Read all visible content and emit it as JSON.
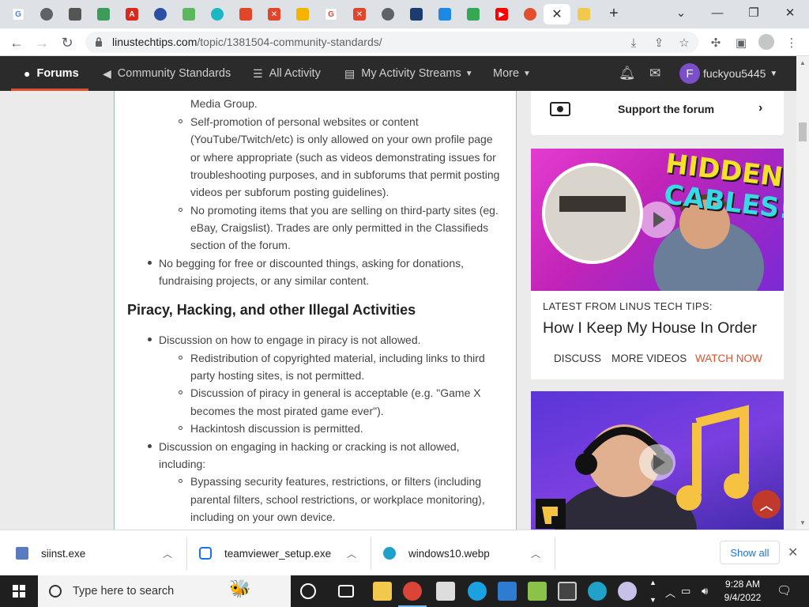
{
  "browser": {
    "tab_count": 22,
    "active_tab_close": "✕",
    "url_domain": "linustechtips.com",
    "url_path": "/topic/1381504-community-standards/"
  },
  "site_nav": {
    "items": [
      {
        "label": "Forums",
        "icon": "comments-icon"
      },
      {
        "label": "Community Standards",
        "icon": "megaphone-icon"
      },
      {
        "label": "All Activity",
        "icon": "list-icon"
      },
      {
        "label": "My Activity Streams",
        "icon": "stream-icon"
      },
      {
        "label": "More",
        "icon": ""
      }
    ],
    "username": "fuckyou5445",
    "avatar_letter": "F",
    "accent_color": "#e0502d"
  },
  "content": {
    "partial_line": "Media Group.",
    "self_promo": [
      "Self-promotion of personal websites or content",
      "(YouTube/Twitch/etc) is only allowed on your own profile page",
      "or where appropriate (such as videos demonstrating issues for",
      "troubleshooting purposes, and in subforums that permit posting",
      "videos per subforum posting guidelines)."
    ],
    "third_party": [
      "No promoting items that you are selling on third-party sites (eg.",
      "eBay, Craigslist). Trades are only permitted in the Classifieds",
      "section of the forum."
    ],
    "begging": [
      "No begging for free or discounted things, asking for donations,",
      "fundraising projects, or any similar content."
    ],
    "heading": "Piracy, Hacking, and other Illegal Activities",
    "piracy": "Discussion on how to engage in piracy is not allowed.",
    "redistribution": [
      "Redistribution of copyrighted material, including links to third",
      "party hosting sites, is not permitted."
    ],
    "piracy_general": [
      "Discussion of piracy in general is acceptable (e.g. \"Game X",
      "becomes the most pirated game ever\")."
    ],
    "hackintosh": "Hackintosh discussion is permitted.",
    "hacking": [
      "Discussion on engaging in hacking or cracking is not allowed,",
      "including:"
    ],
    "bypassing": [
      "Bypassing security features, restrictions, or filters (including",
      "parental filters, school restrictions, or workplace monitoring),",
      "including on your own device."
    ]
  },
  "sidebar": {
    "support_label": "Support the forum",
    "video1_overlay_line1": "HIDDEN",
    "video1_overlay_line2": "CABLES!",
    "kicker": "LATEST FROM LINUS TECH TIPS:",
    "video_title": "How I Keep My House In Order",
    "links": [
      "DISCUSS",
      "MORE VIDEOS",
      "WATCH NOW"
    ],
    "watch_color": "#e0502d"
  },
  "downloads": {
    "items": [
      "siinst.exe",
      "teamviewer_setup.exe",
      "windows10.webp"
    ],
    "show_all": "Show all"
  },
  "taskbar": {
    "search_placeholder": "Type here to search",
    "time": "9:28 AM",
    "date": "9/4/2022"
  }
}
